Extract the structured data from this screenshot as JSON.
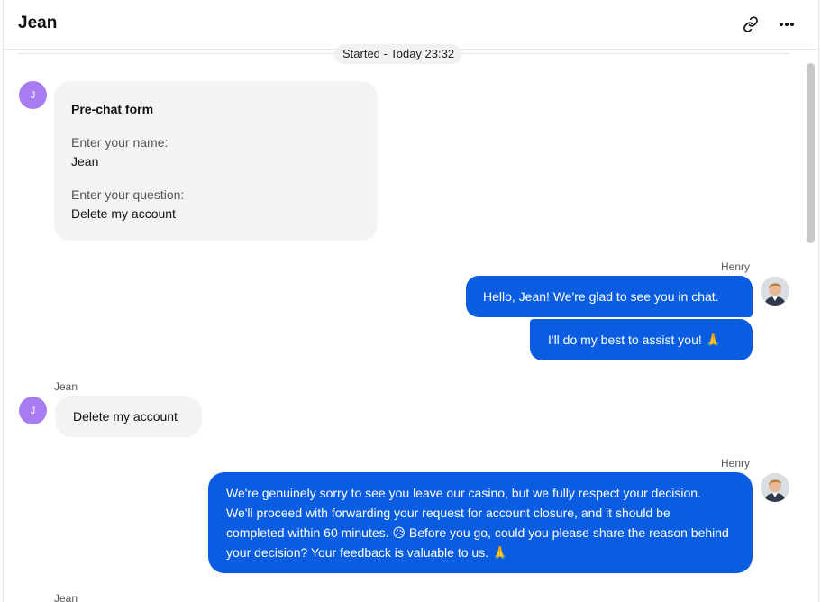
{
  "header": {
    "title": "Jean",
    "link_icon": "link-icon",
    "more_icon": "more-horizontal-icon"
  },
  "started": {
    "text": "Started - Today 23:32"
  },
  "customer": {
    "name": "Jean",
    "initial": "J",
    "avatar_color": "#a77cf1"
  },
  "agent": {
    "name": "Henry"
  },
  "prechat": {
    "title": "Pre-chat form",
    "fields": [
      {
        "question": "Enter your name:",
        "answer": "Jean"
      },
      {
        "question": "Enter your question:",
        "answer": "Delete my account"
      }
    ]
  },
  "messages": [
    {
      "from": "agent",
      "text": "Hello, Jean! We're glad to see you in chat."
    },
    {
      "from": "agent",
      "text": "I'll do my best to assist you! 🙏"
    },
    {
      "from": "customer",
      "text": "Delete my account"
    },
    {
      "from": "agent",
      "text": "We're genuinely sorry to see you leave our casino, but we fully respect your decision. We'll proceed with forwarding your request for account closure, and it should be completed within 60 minutes. 😥 Before you go, could you please share the reason behind your decision? Your feedback is valuable to us. 🙏"
    }
  ],
  "colors": {
    "agent_bubble": "#0a5de0",
    "customer_bubble": "#f3f3f3"
  }
}
